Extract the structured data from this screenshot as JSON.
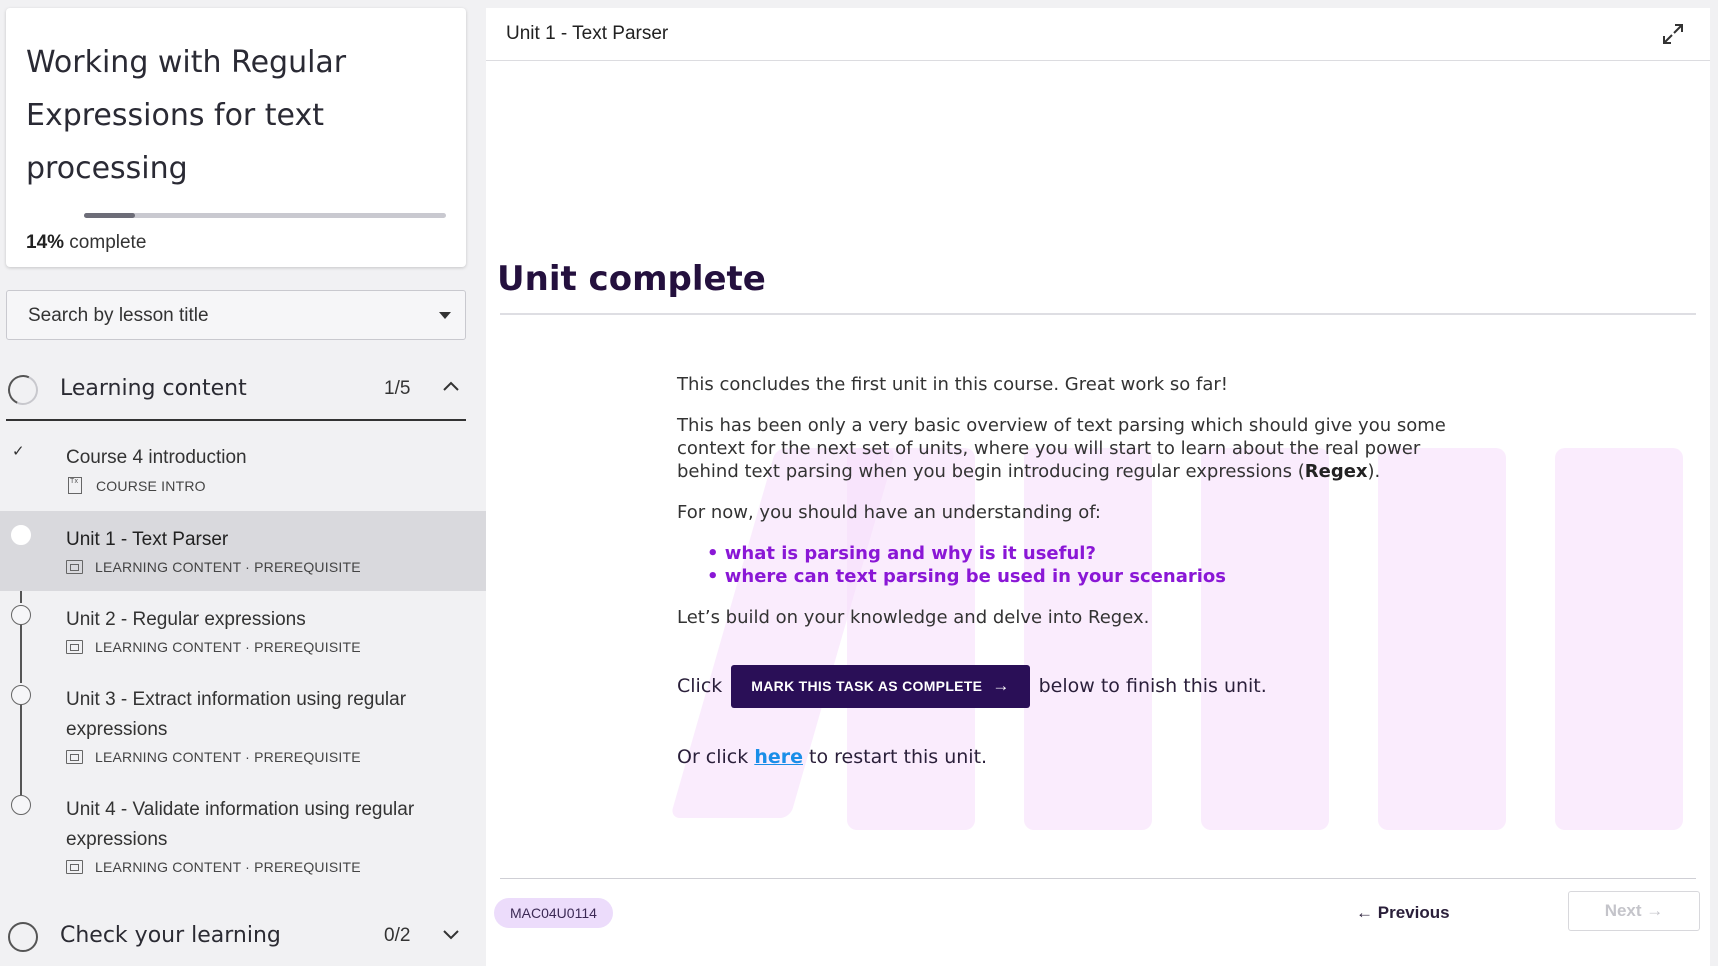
{
  "course": {
    "title": "Working with Regular Expressions for text processing",
    "progress_percent": 14,
    "progress_pct_label": "14%",
    "progress_suffix": " complete"
  },
  "search": {
    "placeholder": "Search by lesson title"
  },
  "sections": [
    {
      "label": "Learning content",
      "count": "1/5",
      "expanded": true
    },
    {
      "label": "Check your learning",
      "count": "0/2",
      "expanded": false
    }
  ],
  "lessons": [
    {
      "title": "Course 4 introduction",
      "meta": "COURSE INTRO",
      "status": "complete"
    },
    {
      "title": "Unit 1 - Text Parser",
      "meta": "LEARNING CONTENT · PREREQUISITE",
      "status": "current"
    },
    {
      "title": "Unit 2 - Regular expressions",
      "meta": "LEARNING CONTENT · PREREQUISITE",
      "status": "incomplete"
    },
    {
      "title": "Unit 3 - Extract information using regular expressions",
      "meta": "LEARNING CONTENT · PREREQUISITE",
      "status": "incomplete"
    },
    {
      "title": "Unit 4 - Validate information using regular expressions",
      "meta": "LEARNING CONTENT · PREREQUISITE",
      "status": "incomplete"
    }
  ],
  "main": {
    "unit_title": "Unit 1 - Text Parser",
    "heading": "Unit complete",
    "p1": "This concludes the first unit in this course. Great work so far!",
    "p2_before": "This has been only a very basic overview of text parsing which should give you some context for the next set of units, where you will start to learn about the real power behind text parsing when you begin introducing regular expressions (",
    "p2_bold": "Regex",
    "p2_after": ").",
    "p3": "For now, you should have an understanding of:",
    "bullets": [
      "what is parsing and why is it useful?",
      "where can text parsing be used in your scenarios"
    ],
    "p4": "Let’s build on your knowledge and delve into Regex.",
    "click_prefix": "Click",
    "mark_button": "MARK THIS TASK AS COMPLETE",
    "click_suffix": "below to finish this unit.",
    "restart_prefix": "Or click ",
    "restart_link": "here",
    "restart_suffix": " to restart this unit."
  },
  "footer": {
    "code": "MAC04U0114",
    "previous": "Previous",
    "next": "Next"
  },
  "colors": {
    "heading": "#24103e",
    "button_bg": "#2a0f57",
    "bullet": "#8a17d6",
    "link": "#1a8ee8",
    "badge_bg": "#ecdcfb",
    "decor": "#f7e0fb"
  }
}
